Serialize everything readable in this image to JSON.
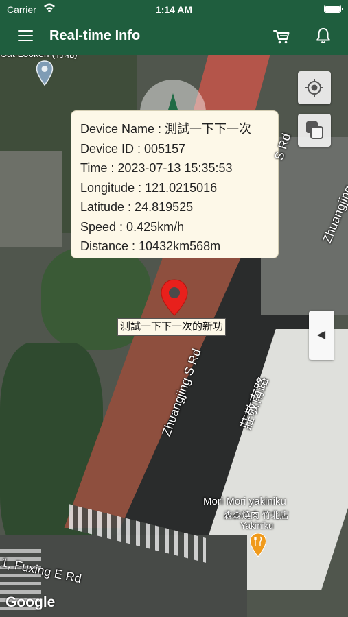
{
  "status_bar": {
    "carrier": "Carrier",
    "time": "1:14 AM"
  },
  "app_bar": {
    "title": "Real-time Info",
    "menu_icon": "hamburger-menu-icon",
    "cart_icon": "cart-icon",
    "bell_icon": "bell-icon",
    "background_color": "#1f5e3e"
  },
  "map": {
    "street_labels": {
      "s_rd_top": "S Rd",
      "zhuangjing_right": "Zhuangjing",
      "zhuangjing_main": "Zhuangjing S Rd",
      "zhuangjing_chinese": "莊敬南路",
      "fuxing": "1, Fuxing E Rd",
      "top_left_partial": "Cat Lookeri (竹北)"
    },
    "poi": {
      "name": "Mori Mori yakiniku",
      "chinese_name": "森森燒肉 竹北店",
      "category": "Yakiniku"
    },
    "google_logo": "Google",
    "controls": {
      "locate_icon": "my-location-icon",
      "layers_icon": "map-layers-icon",
      "drawer_arrow": "◀"
    }
  },
  "device_info": {
    "device_name": "Device Name : 測試一下下一次",
    "device_id": "Device ID : 005157",
    "time": "Time : 2023-07-13 15:35:53",
    "longitude": "Longitude : 121.0215016",
    "latitude": "Latitude : 24.819525",
    "speed": "Speed : 0.425km/h",
    "distance": "Distance : 10432km568m"
  },
  "marker": {
    "label": "測試一下下一次的新功",
    "color": "#e8201c"
  }
}
